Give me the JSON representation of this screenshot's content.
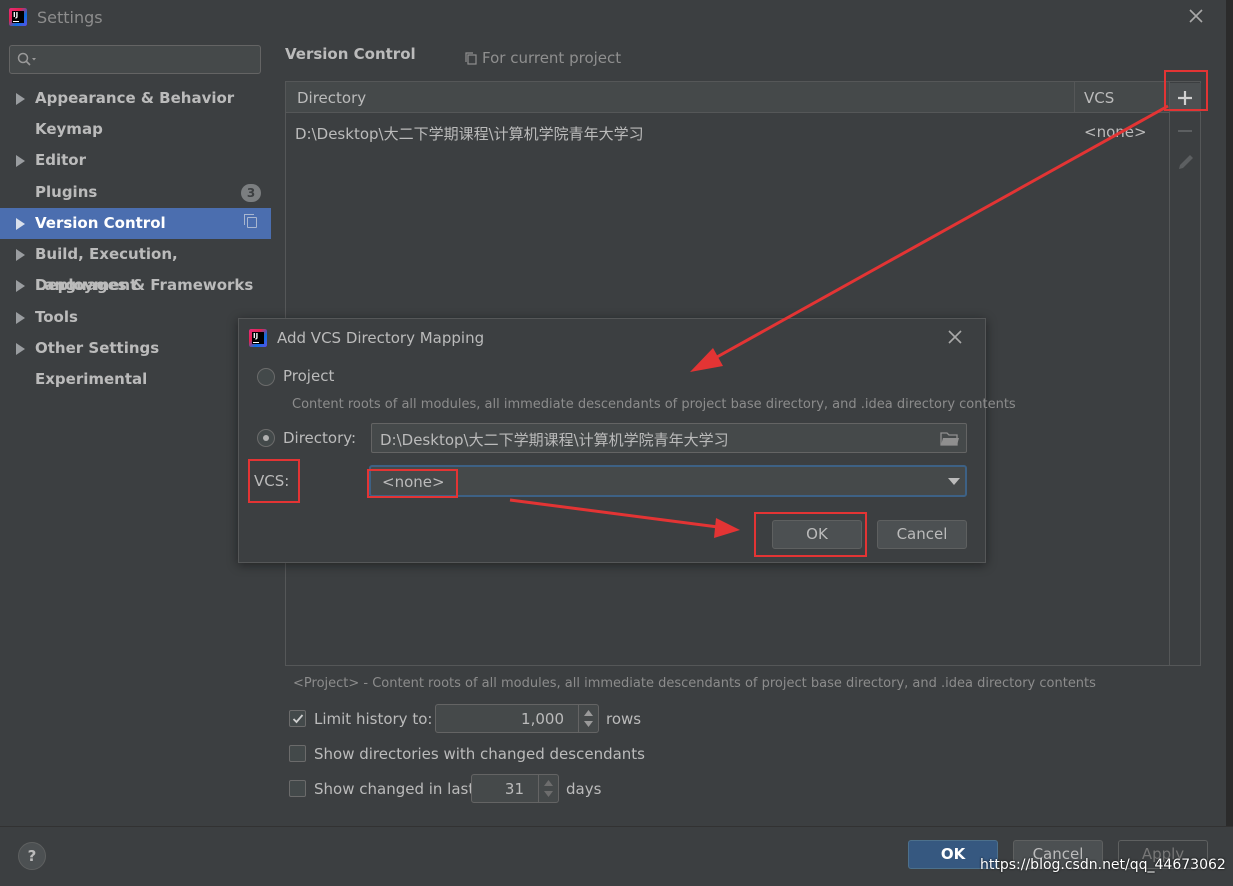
{
  "window": {
    "title": "Settings"
  },
  "sidebar": {
    "search_placeholder": "",
    "items": [
      {
        "label": "Appearance & Behavior",
        "expandable": true
      },
      {
        "label": "Keymap",
        "expandable": false
      },
      {
        "label": "Editor",
        "expandable": true
      },
      {
        "label": "Plugins",
        "expandable": false,
        "badge": "3"
      },
      {
        "label": "Version Control",
        "expandable": true,
        "selected": true
      },
      {
        "label": "Build, Execution, Deployment",
        "expandable": true
      },
      {
        "label": "Languages & Frameworks",
        "expandable": true
      },
      {
        "label": "Tools",
        "expandable": true
      },
      {
        "label": "Other Settings",
        "expandable": true
      },
      {
        "label": "Experimental",
        "expandable": false
      }
    ]
  },
  "main": {
    "title": "Version Control",
    "scope": "For current project",
    "table": {
      "headers": [
        "Directory",
        "VCS"
      ],
      "rows": [
        {
          "directory": "D:\\Desktop\\大二下学期课程\\计算机学院青年大学习",
          "vcs": "<none>"
        }
      ]
    },
    "hint": "<Project> - Content roots of all modules, all immediate descendants of project base directory, and .idea directory contents",
    "limit_history": {
      "label": "Limit history to:",
      "value": "1,000",
      "unit": "rows",
      "checked": true
    },
    "show_dirs": {
      "label": "Show directories with changed descendants",
      "checked": false
    },
    "show_changed": {
      "label": "Show changed in last",
      "value": "31",
      "unit": "days",
      "checked": false
    }
  },
  "dialog": {
    "title": "Add VCS Directory Mapping",
    "project_option": "Project",
    "project_desc": "Content roots of all modules, all immediate descendants of project base directory, and .idea directory contents",
    "directory_option": "Directory:",
    "directory_value": "D:\\Desktop\\大二下学期课程\\计算机学院青年大学习",
    "vcs_label": "VCS:",
    "vcs_value": "<none>",
    "ok": "OK",
    "cancel": "Cancel"
  },
  "footer": {
    "ok": "OK",
    "cancel": "Cancel",
    "apply": "Apply",
    "watermark": "https://blog.csdn.net/qq_44673062"
  },
  "colors": {
    "accent": "#4b6eaf",
    "annotation": "#e33434",
    "background": "#3c3f41"
  }
}
